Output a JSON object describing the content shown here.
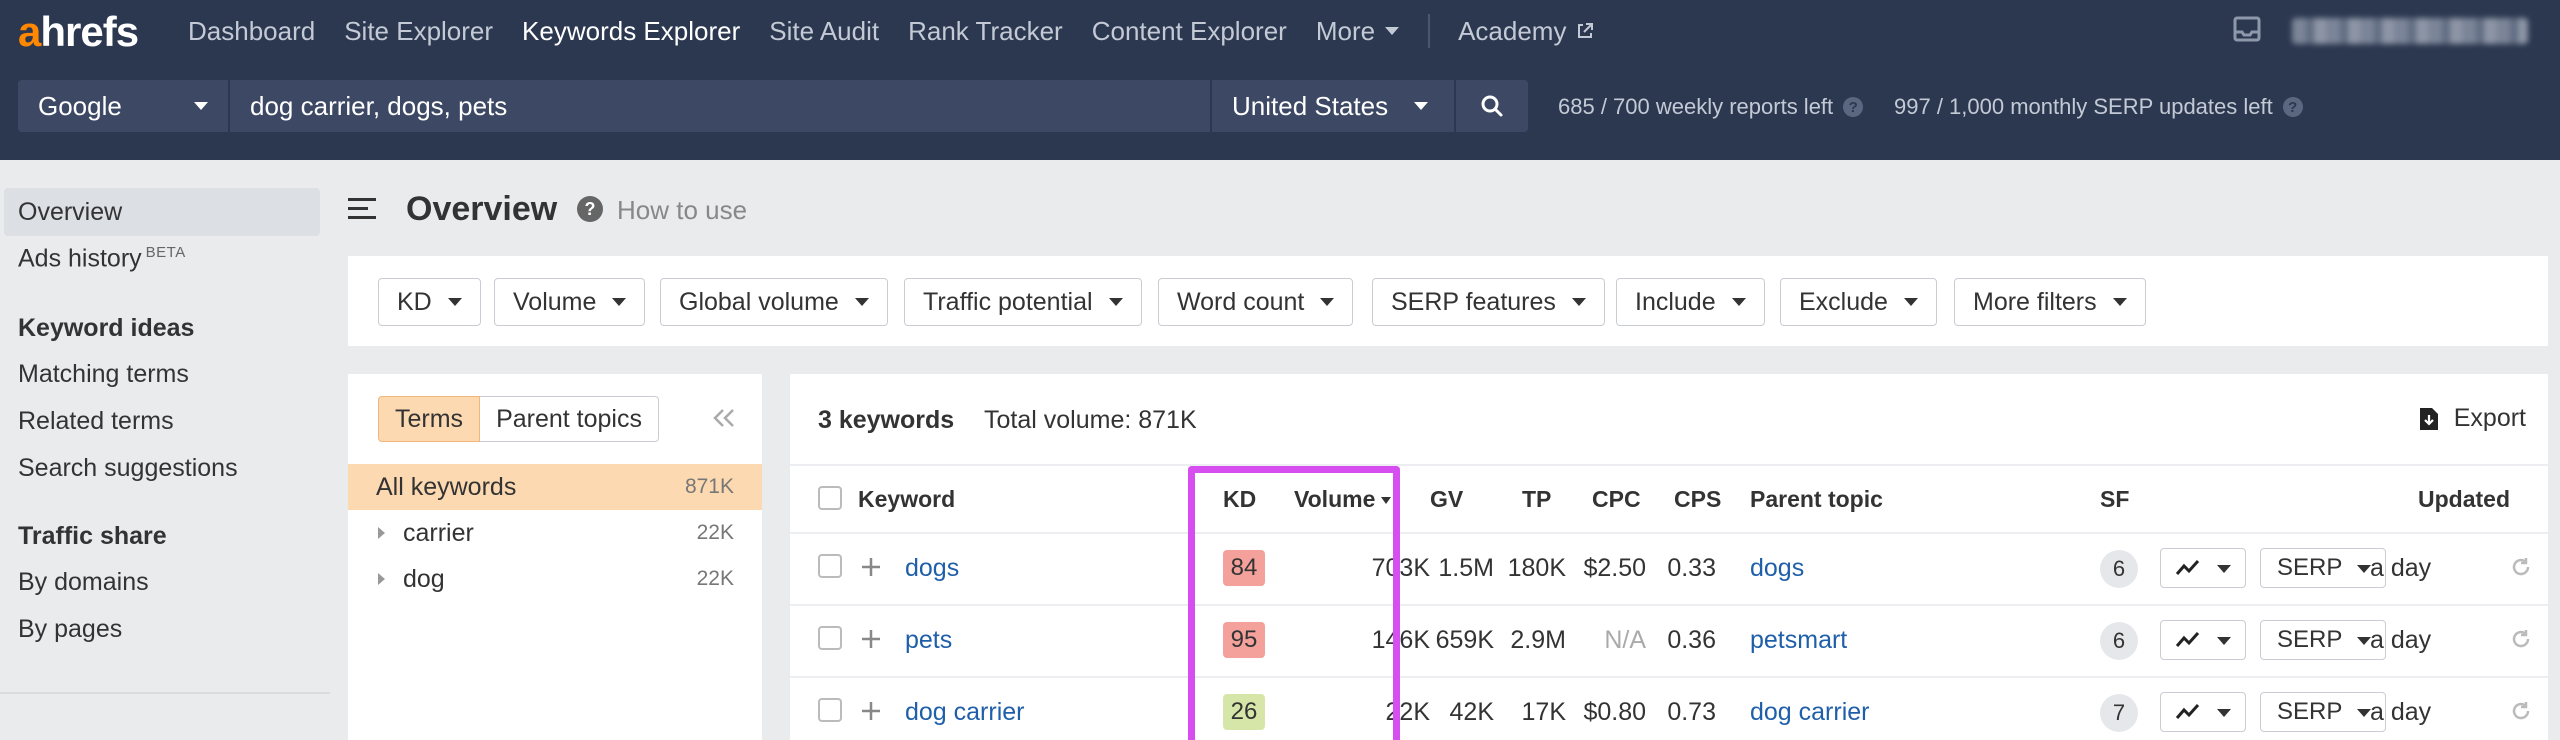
{
  "brand": {
    "first": "a",
    "rest": "hrefs",
    "accent": "#ff8800"
  },
  "nav": {
    "items": [
      "Dashboard",
      "Site Explorer",
      "Keywords Explorer",
      "Site Audit",
      "Rank Tracker",
      "Content Explorer",
      "More"
    ],
    "active": "Keywords Explorer",
    "academy": "Academy"
  },
  "search": {
    "engine": "Google",
    "query": "dog carrier, dogs, pets",
    "country": "United States",
    "weekly_quota": "685 / 700 weekly reports left",
    "monthly_quota": "997 / 1,000 monthly SERP updates left"
  },
  "sidebar": {
    "overview": "Overview",
    "ads_history": "Ads history",
    "beta": "BETA",
    "keyword_ideas_heading": "Keyword ideas",
    "matching_terms": "Matching terms",
    "related_terms": "Related terms",
    "search_suggestions": "Search suggestions",
    "traffic_share_heading": "Traffic share",
    "by_domains": "By domains",
    "by_pages": "By pages"
  },
  "header": {
    "title": "Overview",
    "how_to": "How to use"
  },
  "filters": [
    "KD",
    "Volume",
    "Global volume",
    "Traffic potential",
    "Word count",
    "SERP features",
    "Include",
    "Exclude",
    "More filters"
  ],
  "terms_panel": {
    "tab_terms": "Terms",
    "tab_parent": "Parent topics",
    "rows": [
      {
        "label": "All keywords",
        "count": "871K"
      },
      {
        "label": "carrier",
        "count": "22K"
      },
      {
        "label": "dog",
        "count": "22K"
      }
    ]
  },
  "table": {
    "keyword_count": "3 keywords",
    "total_volume": "Total volume: 871K",
    "export": "Export",
    "columns": {
      "keyword": "Keyword",
      "kd": "KD",
      "volume": "Volume",
      "gv": "GV",
      "tp": "TP",
      "cpc": "CPC",
      "cps": "CPS",
      "parent": "Parent topic",
      "sf": "SF",
      "updated": "Updated"
    },
    "rows": [
      {
        "keyword": "dogs",
        "kd": "84",
        "kd_color": "#f4a19b",
        "volume": "703K",
        "gv": "1.5M",
        "tp": "180K",
        "cpc": "$2.50",
        "cps": "0.33",
        "parent": "dogs",
        "sf": "6",
        "serp": "SERP",
        "updated": "a day"
      },
      {
        "keyword": "pets",
        "kd": "95",
        "kd_color": "#f4a19b",
        "volume": "146K",
        "gv": "659K",
        "tp": "2.9M",
        "cpc": "N/A",
        "cps": "0.36",
        "parent": "petsmart",
        "sf": "6",
        "serp": "SERP",
        "updated": "a day"
      },
      {
        "keyword": "dog carrier",
        "kd": "26",
        "kd_color": "#d6e6a8",
        "volume": "22K",
        "gv": "42K",
        "tp": "17K",
        "cpc": "$0.80",
        "cps": "0.73",
        "parent": "dog carrier",
        "sf": "7",
        "serp": "SERP",
        "updated": "a day"
      }
    ]
  },
  "highlight_color": "#d74ef0"
}
